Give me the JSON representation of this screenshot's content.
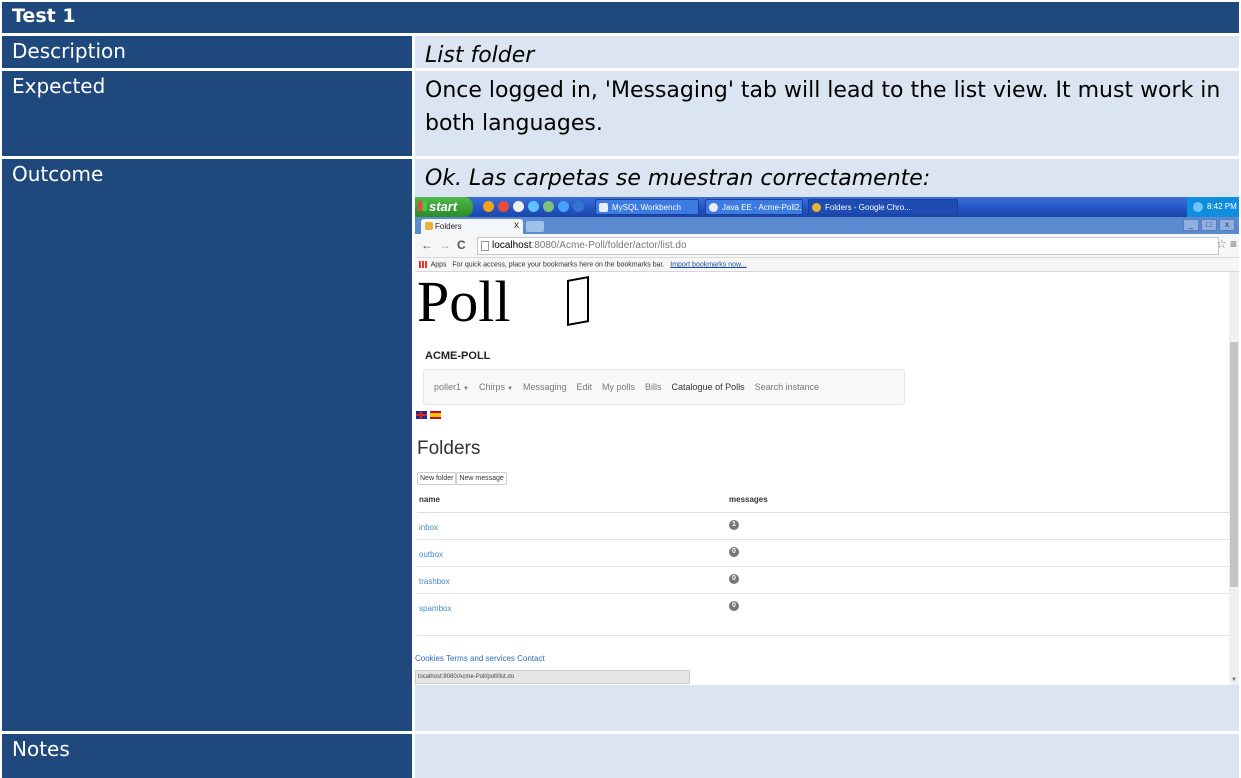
{
  "table": {
    "title": "Test 1",
    "rows": [
      {
        "label": "Description",
        "value": "List folder"
      },
      {
        "label": "Expected",
        "value": "Once logged in, 'Messaging' tab will lead to the list view. It must work in both languages."
      },
      {
        "label": "Outcome",
        "value": "Ok. Las carpetas se muestran correctamente:"
      },
      {
        "label": "Notes",
        "value": ""
      }
    ]
  },
  "screenshot": {
    "taskbar": {
      "start_label": "start",
      "tasks": [
        {
          "label": "MySQL Workbench",
          "active": false
        },
        {
          "label": "Java EE - Acme-Poll2...",
          "active": false
        },
        {
          "label": "Folders - Google Chro...",
          "active": true
        }
      ],
      "clock": "8:42 PM"
    },
    "browser": {
      "tab_title": "Folders",
      "tab_close": "x",
      "url_host": "localhost",
      "url_rest": ":8080/Acme-Poll/folder/actor/list.do",
      "bookmarks_apps": "Apps",
      "bookmarks_text": "For quick access, place your bookmarks here on the bookmarks bar.",
      "bookmarks_link": "Import bookmarks now...",
      "window_controls": [
        "_",
        "□",
        "x"
      ]
    },
    "page": {
      "logo_text": "Poll",
      "brand": "ACME-POLL",
      "nav": [
        {
          "label": "poller1",
          "dropdown": true,
          "dark": false
        },
        {
          "label": "Chirps",
          "dropdown": true,
          "dark": false
        },
        {
          "label": "Messaging",
          "dropdown": false,
          "dark": false
        },
        {
          "label": "Edit",
          "dropdown": false,
          "dark": false
        },
        {
          "label": "My polls",
          "dropdown": false,
          "dark": false
        },
        {
          "label": "Bills",
          "dropdown": false,
          "dark": false
        },
        {
          "label": "Catalogue of Polls",
          "dropdown": false,
          "dark": true
        },
        {
          "label": "Search instance",
          "dropdown": false,
          "dark": false
        }
      ],
      "heading": "Folders",
      "new_folder_label": "New folder",
      "new_message_label": "New message",
      "col_name": "name",
      "col_messages": "messages",
      "folders": [
        {
          "name": "inbox",
          "messages": "1"
        },
        {
          "name": "outbox",
          "messages": "0"
        },
        {
          "name": "trashbox",
          "messages": "0"
        },
        {
          "name": "spambox",
          "messages": "0"
        }
      ],
      "footer": "Cookies Terms and services Contact",
      "status_url": "localhost:8080/Acme-Poll/poll/list.do"
    }
  }
}
